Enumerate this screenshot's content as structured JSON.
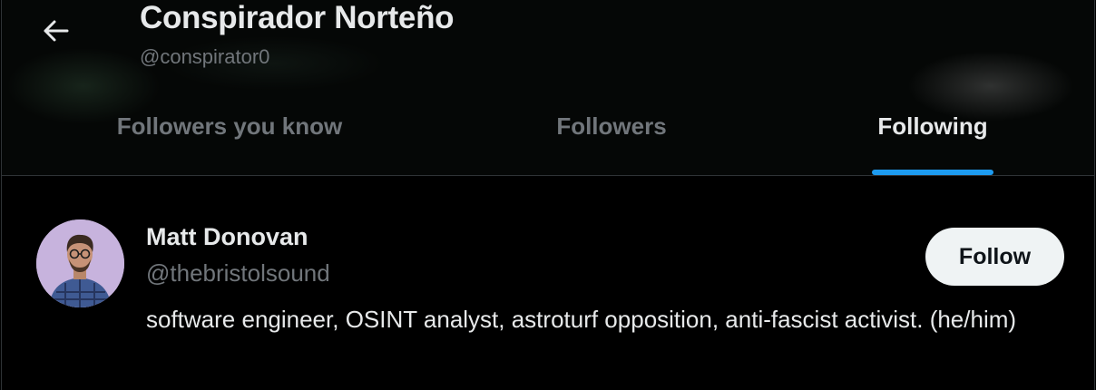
{
  "header": {
    "back_icon": "arrow-left-icon",
    "title": "Conspirador Norteño",
    "handle": "@conspirator0"
  },
  "tabs": [
    {
      "label": "Followers you know",
      "active": false
    },
    {
      "label": "Followers",
      "active": false
    },
    {
      "label": "Following",
      "active": true
    }
  ],
  "user": {
    "name": "Matt Donovan",
    "handle": "@thebristolsound",
    "bio": "software engineer, OSINT analyst, astroturf opposition, anti-fascist activist. (he/him)",
    "follow_label": "Follow"
  },
  "colors": {
    "background": "#000000",
    "text_primary": "#e7e9ea",
    "text_secondary": "#71767b",
    "accent": "#1d9bf0",
    "divider": "#2f3336",
    "follow_button_bg": "#eff3f4",
    "avatar_bg": "#c7b3dd"
  }
}
